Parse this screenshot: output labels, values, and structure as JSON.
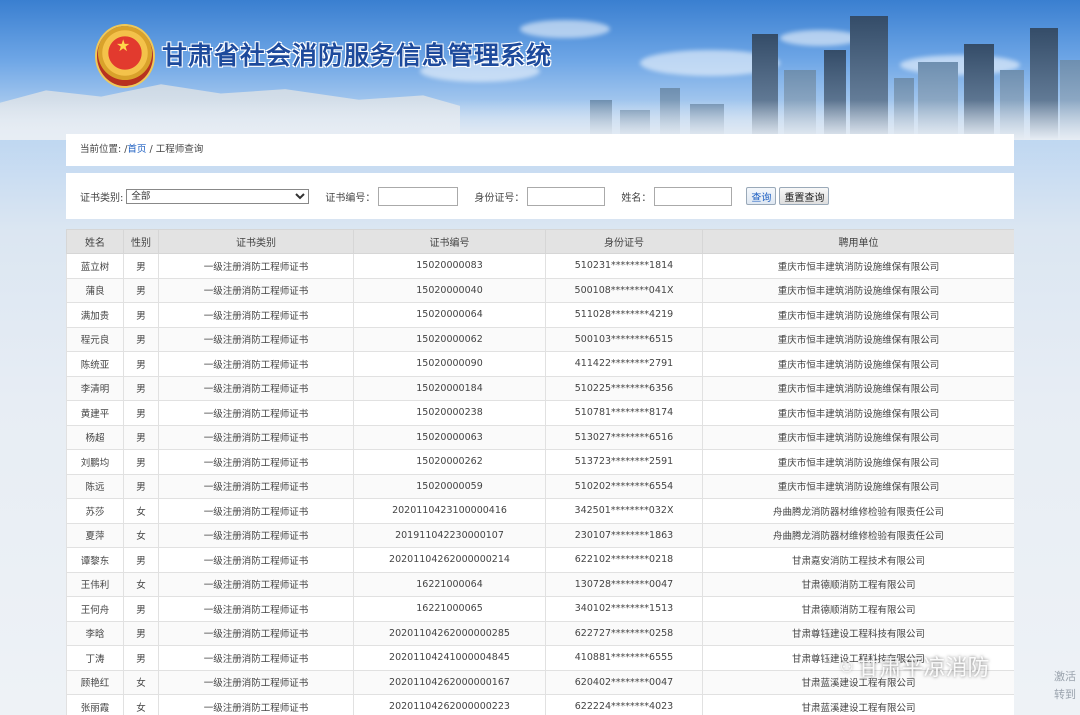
{
  "header": {
    "title": "甘肃省社会消防服务信息管理系统",
    "emblem_icon": "fire-rescue-emblem"
  },
  "breadcrumb": {
    "prefix": "当前位置: /",
    "home": "首页",
    "separator": " / ",
    "current": "工程师查询"
  },
  "search": {
    "cert_type_label": "证书类别:",
    "cert_type_selected": "全部",
    "cert_no_label": "证书编号：",
    "cert_no_value": "",
    "id_label": "身份证号：",
    "id_value": "",
    "name_label": "姓名：",
    "name_value": "",
    "query_button": "查询",
    "reset_button": "重置查询"
  },
  "table": {
    "columns": [
      "姓名",
      "性别",
      "证书类别",
      "证书编号",
      "身份证号",
      "聘用单位"
    ],
    "rows": [
      [
        "蓝立树",
        "男",
        "一级注册消防工程师证书",
        "15020000083",
        "510231********1814",
        "重庆市恒丰建筑消防设施维保有限公司"
      ],
      [
        "蒲良",
        "男",
        "一级注册消防工程师证书",
        "15020000040",
        "500108********041X",
        "重庆市恒丰建筑消防设施维保有限公司"
      ],
      [
        "满加贵",
        "男",
        "一级注册消防工程师证书",
        "15020000064",
        "511028********4219",
        "重庆市恒丰建筑消防设施维保有限公司"
      ],
      [
        "程元良",
        "男",
        "一级注册消防工程师证书",
        "15020000062",
        "500103********6515",
        "重庆市恒丰建筑消防设施维保有限公司"
      ],
      [
        "陈统亚",
        "男",
        "一级注册消防工程师证书",
        "15020000090",
        "411422********2791",
        "重庆市恒丰建筑消防设施维保有限公司"
      ],
      [
        "李清明",
        "男",
        "一级注册消防工程师证书",
        "15020000184",
        "510225********6356",
        "重庆市恒丰建筑消防设施维保有限公司"
      ],
      [
        "黄建平",
        "男",
        "一级注册消防工程师证书",
        "15020000238",
        "510781********8174",
        "重庆市恒丰建筑消防设施维保有限公司"
      ],
      [
        "杨超",
        "男",
        "一级注册消防工程师证书",
        "15020000063",
        "513027********6516",
        "重庆市恒丰建筑消防设施维保有限公司"
      ],
      [
        "刘鹏均",
        "男",
        "一级注册消防工程师证书",
        "15020000262",
        "513723********2591",
        "重庆市恒丰建筑消防设施维保有限公司"
      ],
      [
        "陈远",
        "男",
        "一级注册消防工程师证书",
        "15020000059",
        "510202********6554",
        "重庆市恒丰建筑消防设施维保有限公司"
      ],
      [
        "苏莎",
        "女",
        "一级注册消防工程师证书",
        "2020110423100000416",
        "342501********032X",
        "舟曲腾龙消防器材维修检验有限责任公司"
      ],
      [
        "夏萍",
        "女",
        "一级注册消防工程师证书",
        "201911042230000107",
        "230107********1863",
        "舟曲腾龙消防器材维修检验有限责任公司"
      ],
      [
        "谭黎东",
        "男",
        "一级注册消防工程师证书",
        "20201104262000000214",
        "622102********0218",
        "甘肃嘉安消防工程技术有限公司"
      ],
      [
        "王伟利",
        "女",
        "一级注册消防工程师证书",
        "16221000064",
        "130728********0047",
        "甘肃德顺消防工程有限公司"
      ],
      [
        "王何舟",
        "男",
        "一级注册消防工程师证书",
        "16221000065",
        "340102********1513",
        "甘肃德顺消防工程有限公司"
      ],
      [
        "李晗",
        "男",
        "一级注册消防工程师证书",
        "20201104262000000285",
        "622727********0258",
        "甘肃尊钰建设工程科技有限公司"
      ],
      [
        "丁涛",
        "男",
        "一级注册消防工程师证书",
        "20201104241000004845",
        "410881********6555",
        "甘肃尊钰建设工程科技有限公司"
      ],
      [
        "顾艳红",
        "女",
        "一级注册消防工程师证书",
        "20201104262000000167",
        "620402********0047",
        "甘肃蓝溪建设工程有限公司"
      ],
      [
        "张丽霞",
        "女",
        "一级注册消防工程师证书",
        "20201104262000000223",
        "622224********4023",
        "甘肃蓝溪建设工程有限公司"
      ]
    ]
  },
  "watermark": {
    "icon": "wechat-icon",
    "text": "甘肃平凉消防",
    "corner_line1": "激活",
    "corner_line2": "转到"
  }
}
